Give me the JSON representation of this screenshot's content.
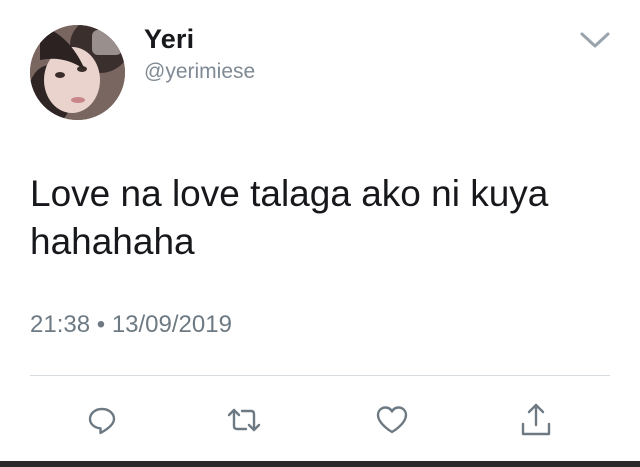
{
  "tweet": {
    "display_name": "Yeri",
    "handle": "@yerimiese",
    "text_line1": "Love na love talaga ako ni kuya",
    "text_line2": "hahahaha",
    "time": "21:38",
    "separator": "•",
    "date": "13/09/2019"
  },
  "actions": [
    {
      "name": "reply",
      "icon": "reply-icon"
    },
    {
      "name": "retweet",
      "icon": "retweet-icon"
    },
    {
      "name": "like",
      "icon": "heart-icon"
    },
    {
      "name": "share",
      "icon": "share-icon"
    }
  ],
  "colors": {
    "text": "#16181b",
    "secondary_text": "#7f8a94",
    "icon": "#6e7a83",
    "divider": "#d7dde1"
  }
}
